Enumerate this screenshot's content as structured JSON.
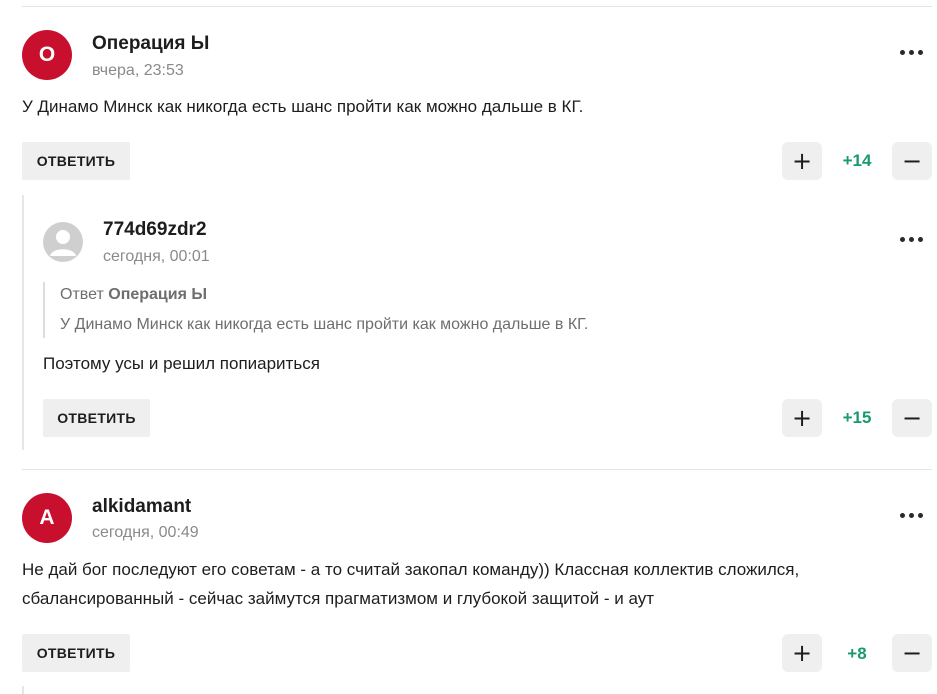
{
  "comments": [
    {
      "avatar_letter": "О",
      "author": "Операция Ы",
      "time": "вчера, 23:53",
      "text": "У Динамо Минск как никогда есть шанс пройти как можно дальше в КГ.",
      "reply_label": "ОТВЕТИТЬ",
      "score": "+14",
      "avatar_color": "#c8102e"
    },
    {
      "author": "774d69zdr2",
      "time": "сегодня, 00:01",
      "quote_prefix": "Ответ",
      "quote_author": "Операция Ы",
      "quote_text": "У Динамо Минск как никогда есть шанс пройти как можно дальше в КГ.",
      "text": "Поэтому усы и решил попиариться",
      "reply_label": "ОТВЕТИТЬ",
      "score": "+15"
    },
    {
      "avatar_letter": "A",
      "author": "alkidamant",
      "time": "сегодня, 00:49",
      "text_line1": "Не дай бог последуют его советам - а то считай закопал команду)) Классная коллектив сложился,",
      "text_line2": "сбалансированный - сейчас займутся прагматизмом и глубокой защитой - и аут",
      "reply_label": "ОТВЕТИТЬ",
      "score": "+8",
      "avatar_color": "#c8102e"
    }
  ],
  "vote": {
    "plus": "+",
    "minus": "−"
  },
  "colors": {
    "accent": "#c8102e",
    "score": "#1a9a6c",
    "button_bg": "#efefef"
  },
  "icons": {
    "more": "more-dots-icon",
    "user": "user-placeholder-icon"
  }
}
